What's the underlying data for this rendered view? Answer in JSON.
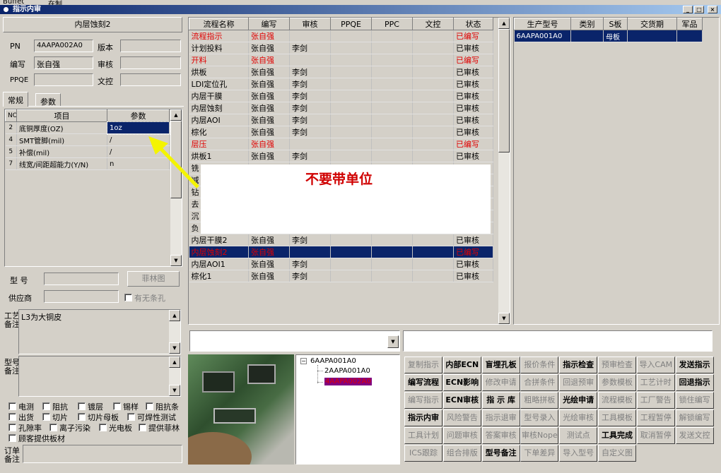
{
  "topbar": {
    "items": [
      "Buffet",
      "在制"
    ]
  },
  "window": {
    "title": "指示内审"
  },
  "left": {
    "header": "内层蚀刻2",
    "pn_label": "PN",
    "pn_value": "4AAPA002A0",
    "version_label": "版本",
    "version_value": "",
    "author_label": "编写",
    "author_value": "张自强",
    "review_label": "审核",
    "review_value": "",
    "ppqe_label": "PPQE",
    "ppqe_value": "",
    "doc_label": "文控",
    "doc_value": "",
    "tabs": [
      "常规",
      "参数"
    ],
    "param_headers": [
      "NO",
      "项目",
      "参数"
    ],
    "params": [
      {
        "no": "2",
        "item": "底铜厚度(OZ)",
        "value": "1oz",
        "selected": true
      },
      {
        "no": "4",
        "item": "SMT管脚(mil)",
        "value": "/"
      },
      {
        "no": "5",
        "item": "补偿(mil)",
        "value": "/"
      },
      {
        "no": "7",
        "item": "线宽/间距超能力(Y/N)",
        "value": "n"
      }
    ],
    "model_label": "型  号",
    "feilin_button": "菲林图",
    "supplier_label": "供应商",
    "has_strip_label": "有无条孔",
    "process_note_label": "工艺备注",
    "process_note": "L3为大铜皮",
    "model_note_label": "型号备注",
    "model_note": "",
    "options": [
      [
        "电测",
        "阻抗",
        "镀层",
        "锡样",
        "阻抗条"
      ],
      [
        "出货",
        "切片",
        "切片母板",
        "可焊性测试"
      ],
      [
        "孔隙率",
        "离子污染",
        "光电板",
        "提供菲林"
      ],
      [
        "顾客提供板材"
      ]
    ],
    "order_note_label": "订单备注"
  },
  "flow": {
    "headers": [
      "流程名称",
      "编写",
      "审核",
      "PPQE",
      "PPC",
      "文控",
      "状态"
    ],
    "rows": [
      {
        "name": "流程指示",
        "author": "张自强",
        "review": "",
        "status": "已编写",
        "red": true
      },
      {
        "name": "计划投料",
        "author": "张自强",
        "review": "李剑",
        "status": "已审核"
      },
      {
        "name": "开料",
        "author": "张自强",
        "review": "",
        "status": "已编写",
        "red": true
      },
      {
        "name": "烘板",
        "author": "张自强",
        "review": "李剑",
        "status": "已审核"
      },
      {
        "name": "LDI定位孔",
        "author": "张自强",
        "review": "李剑",
        "status": "已审核"
      },
      {
        "name": "内层干膜",
        "author": "张自强",
        "review": "李剑",
        "status": "已审核"
      },
      {
        "name": "内层蚀刻",
        "author": "张自强",
        "review": "李剑",
        "status": "已审核"
      },
      {
        "name": "内层AOI",
        "author": "张自强",
        "review": "李剑",
        "status": "已审核"
      },
      {
        "name": "棕化",
        "author": "张自强",
        "review": "李剑",
        "status": "已审核"
      },
      {
        "name": "层压",
        "author": "张自强",
        "review": "",
        "status": "已编写",
        "red": true
      },
      {
        "name": "烘板1",
        "author": "张自强",
        "review": "李剑",
        "status": "已审核"
      },
      {
        "name": "铣",
        "author": "",
        "review": "",
        "status": ""
      },
      {
        "name": "减",
        "author": "",
        "review": "",
        "status": ""
      },
      {
        "name": "钻",
        "author": "",
        "review": "",
        "status": ""
      },
      {
        "name": "去",
        "author": "",
        "review": "",
        "status": ""
      },
      {
        "name": "沉",
        "author": "",
        "review": "",
        "status": ""
      },
      {
        "name": "负",
        "author": "",
        "review": "",
        "status": ""
      },
      {
        "name": "内层干膜2",
        "author": "张自强",
        "review": "李剑",
        "status": "已审核"
      },
      {
        "name": "内层蚀刻2",
        "author": "张自强",
        "review": "",
        "status": "已编写",
        "red": true,
        "selected": true
      },
      {
        "name": "内层AOI1",
        "author": "张自强",
        "review": "李剑",
        "status": "已审核"
      },
      {
        "name": "棕化1",
        "author": "张自强",
        "review": "李剑",
        "status": "已审核"
      }
    ],
    "overlay_text": "不要带单位"
  },
  "production": {
    "headers": [
      "生产型号",
      "类别",
      "S板",
      "交货期",
      "军品"
    ],
    "rows": [
      {
        "model": "6AAPA001A0",
        "category": "",
        "sboard": "母板",
        "delivery": "",
        "military": ""
      }
    ]
  },
  "tree": {
    "root": "6AAPA001A0",
    "children": [
      "2AAPA001A0",
      "4AAPA002A0"
    ]
  },
  "actions": [
    [
      {
        "t": "复制指示",
        "on": false
      },
      {
        "t": "内部ECN",
        "on": true
      },
      {
        "t": "盲埋孔板",
        "on": true
      },
      {
        "t": "报价条件",
        "on": false
      },
      {
        "t": "指示检查",
        "on": true
      },
      {
        "t": "预审检查",
        "on": false
      },
      {
        "t": "导入CAM",
        "on": false
      },
      {
        "t": "发送指示",
        "on": true
      }
    ],
    [
      {
        "t": "编写流程",
        "on": true
      },
      {
        "t": "ECN影响",
        "on": true
      },
      {
        "t": "修改申请",
        "on": false
      },
      {
        "t": "合拼条件",
        "on": false
      },
      {
        "t": "回退预审",
        "on": false
      },
      {
        "t": "参数模板",
        "on": false
      },
      {
        "t": "工艺计时",
        "on": false
      },
      {
        "t": "回退指示",
        "on": true
      }
    ],
    [
      {
        "t": "编写指示",
        "on": false
      },
      {
        "t": "ECN审核",
        "on": true
      },
      {
        "t": "指 示 库",
        "on": true
      },
      {
        "t": "粗略拼板",
        "on": false
      },
      {
        "t": "光绘申请",
        "on": true
      },
      {
        "t": "流程模板",
        "on": false
      },
      {
        "t": "工厂警告",
        "on": false
      },
      {
        "t": "锁住编写",
        "on": false
      }
    ],
    [
      {
        "t": "指示内审",
        "on": true
      },
      {
        "t": "风险警告",
        "on": false
      },
      {
        "t": "指示退审",
        "on": false
      },
      {
        "t": "型号录入",
        "on": false
      },
      {
        "t": "光绘审核",
        "on": false
      },
      {
        "t": "工具模板",
        "on": false
      },
      {
        "t": "工程暂停",
        "on": false
      },
      {
        "t": "解锁编写",
        "on": false
      }
    ],
    [
      {
        "t": "工具计划",
        "on": false
      },
      {
        "t": "问题审核",
        "on": false
      },
      {
        "t": "答案审核",
        "on": false
      },
      {
        "t": "审核Nope",
        "on": false
      },
      {
        "t": "测试点",
        "on": false
      },
      {
        "t": "工具完成",
        "on": true
      },
      {
        "t": "取消暂停",
        "on": false
      },
      {
        "t": "发送文控",
        "on": false
      }
    ],
    [
      {
        "t": "ICS跟踪",
        "on": false
      },
      {
        "t": "组合排版",
        "on": false
      },
      {
        "t": "型号备注",
        "on": true
      },
      {
        "t": "下单差异",
        "on": false
      },
      {
        "t": "导入型号",
        "on": false
      },
      {
        "t": "自定义图",
        "on": false
      }
    ]
  ]
}
